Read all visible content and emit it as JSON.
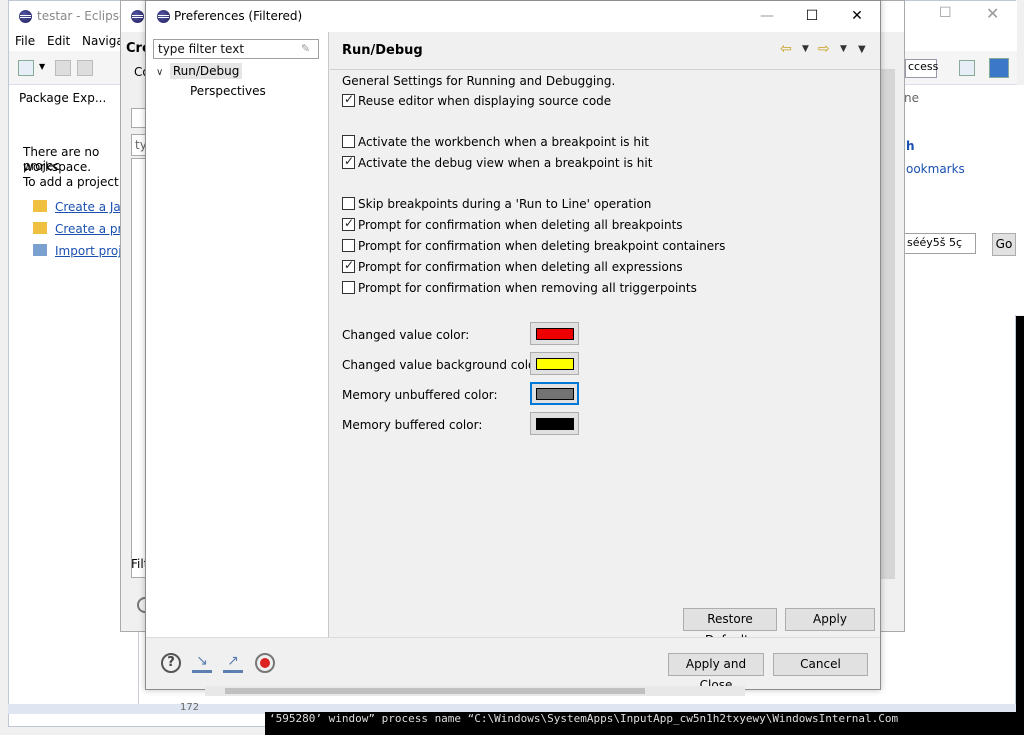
{
  "background_window": {
    "title": "testar - Eclipse I",
    "menu": [
      "File",
      "Edit",
      "Navigat"
    ],
    "package_tab": "Package Exp...",
    "empty_text_1": "There are no projec",
    "empty_text_2": "workspace.",
    "empty_text_3": "To add a project:",
    "links": [
      "Create a Java",
      "Create a proj",
      "Import proje"
    ],
    "right_links": [
      "h",
      "ookmarks"
    ],
    "right_search_value": "sééy5š 5ç",
    "go_label": "Go",
    "access_field": "ccess",
    "right_tab_fragment": "ne",
    "console_text": "‘595280’ window” process name “C:\\Windows\\SystemApps\\InputApp_cw5n1h2txyewy\\WindowsInternal.Com",
    "status_fragment": "172"
  },
  "back_dialog": {
    "title": "",
    "heading_fragment": "Cre",
    "label_fragment": "Co",
    "filter_fragment": "ty",
    "footer_fragment": "Filt"
  },
  "dialog": {
    "title": "Preferences (Filtered)",
    "filter_placeholder": "type filter text",
    "tree": {
      "root": "Run/Debug",
      "child": "Perspectives"
    },
    "page_title": "Run/Debug",
    "description": "General Settings for Running and Debugging.",
    "checkboxes": [
      {
        "label": "Reuse editor when displaying source code",
        "checked": true
      },
      {
        "label": "Activate the workbench when a breakpoint is hit",
        "checked": false
      },
      {
        "label": "Activate the debug view when a breakpoint is hit",
        "checked": true
      },
      {
        "label": "Skip breakpoints during a 'Run to Line' operation",
        "checked": false
      },
      {
        "label": "Prompt for confirmation when deleting all breakpoints",
        "checked": true
      },
      {
        "label": "Prompt for confirmation when deleting breakpoint containers",
        "checked": false
      },
      {
        "label": "Prompt for confirmation when deleting all expressions",
        "checked": true
      },
      {
        "label": "Prompt for confirmation when removing all triggerpoints",
        "checked": false
      }
    ],
    "colors": [
      {
        "label": "Changed value color:",
        "color": "#ee0000"
      },
      {
        "label": "Changed value background color:",
        "color": "#ffff00"
      },
      {
        "label": "Memory unbuffered color:",
        "color": "#737373"
      },
      {
        "label": "Memory buffered color:",
        "color": "#000000"
      }
    ],
    "buttons": {
      "restore_defaults": "Restore Defaults",
      "apply": "Apply",
      "apply_and_close": "Apply and Close",
      "cancel": "Cancel"
    }
  }
}
